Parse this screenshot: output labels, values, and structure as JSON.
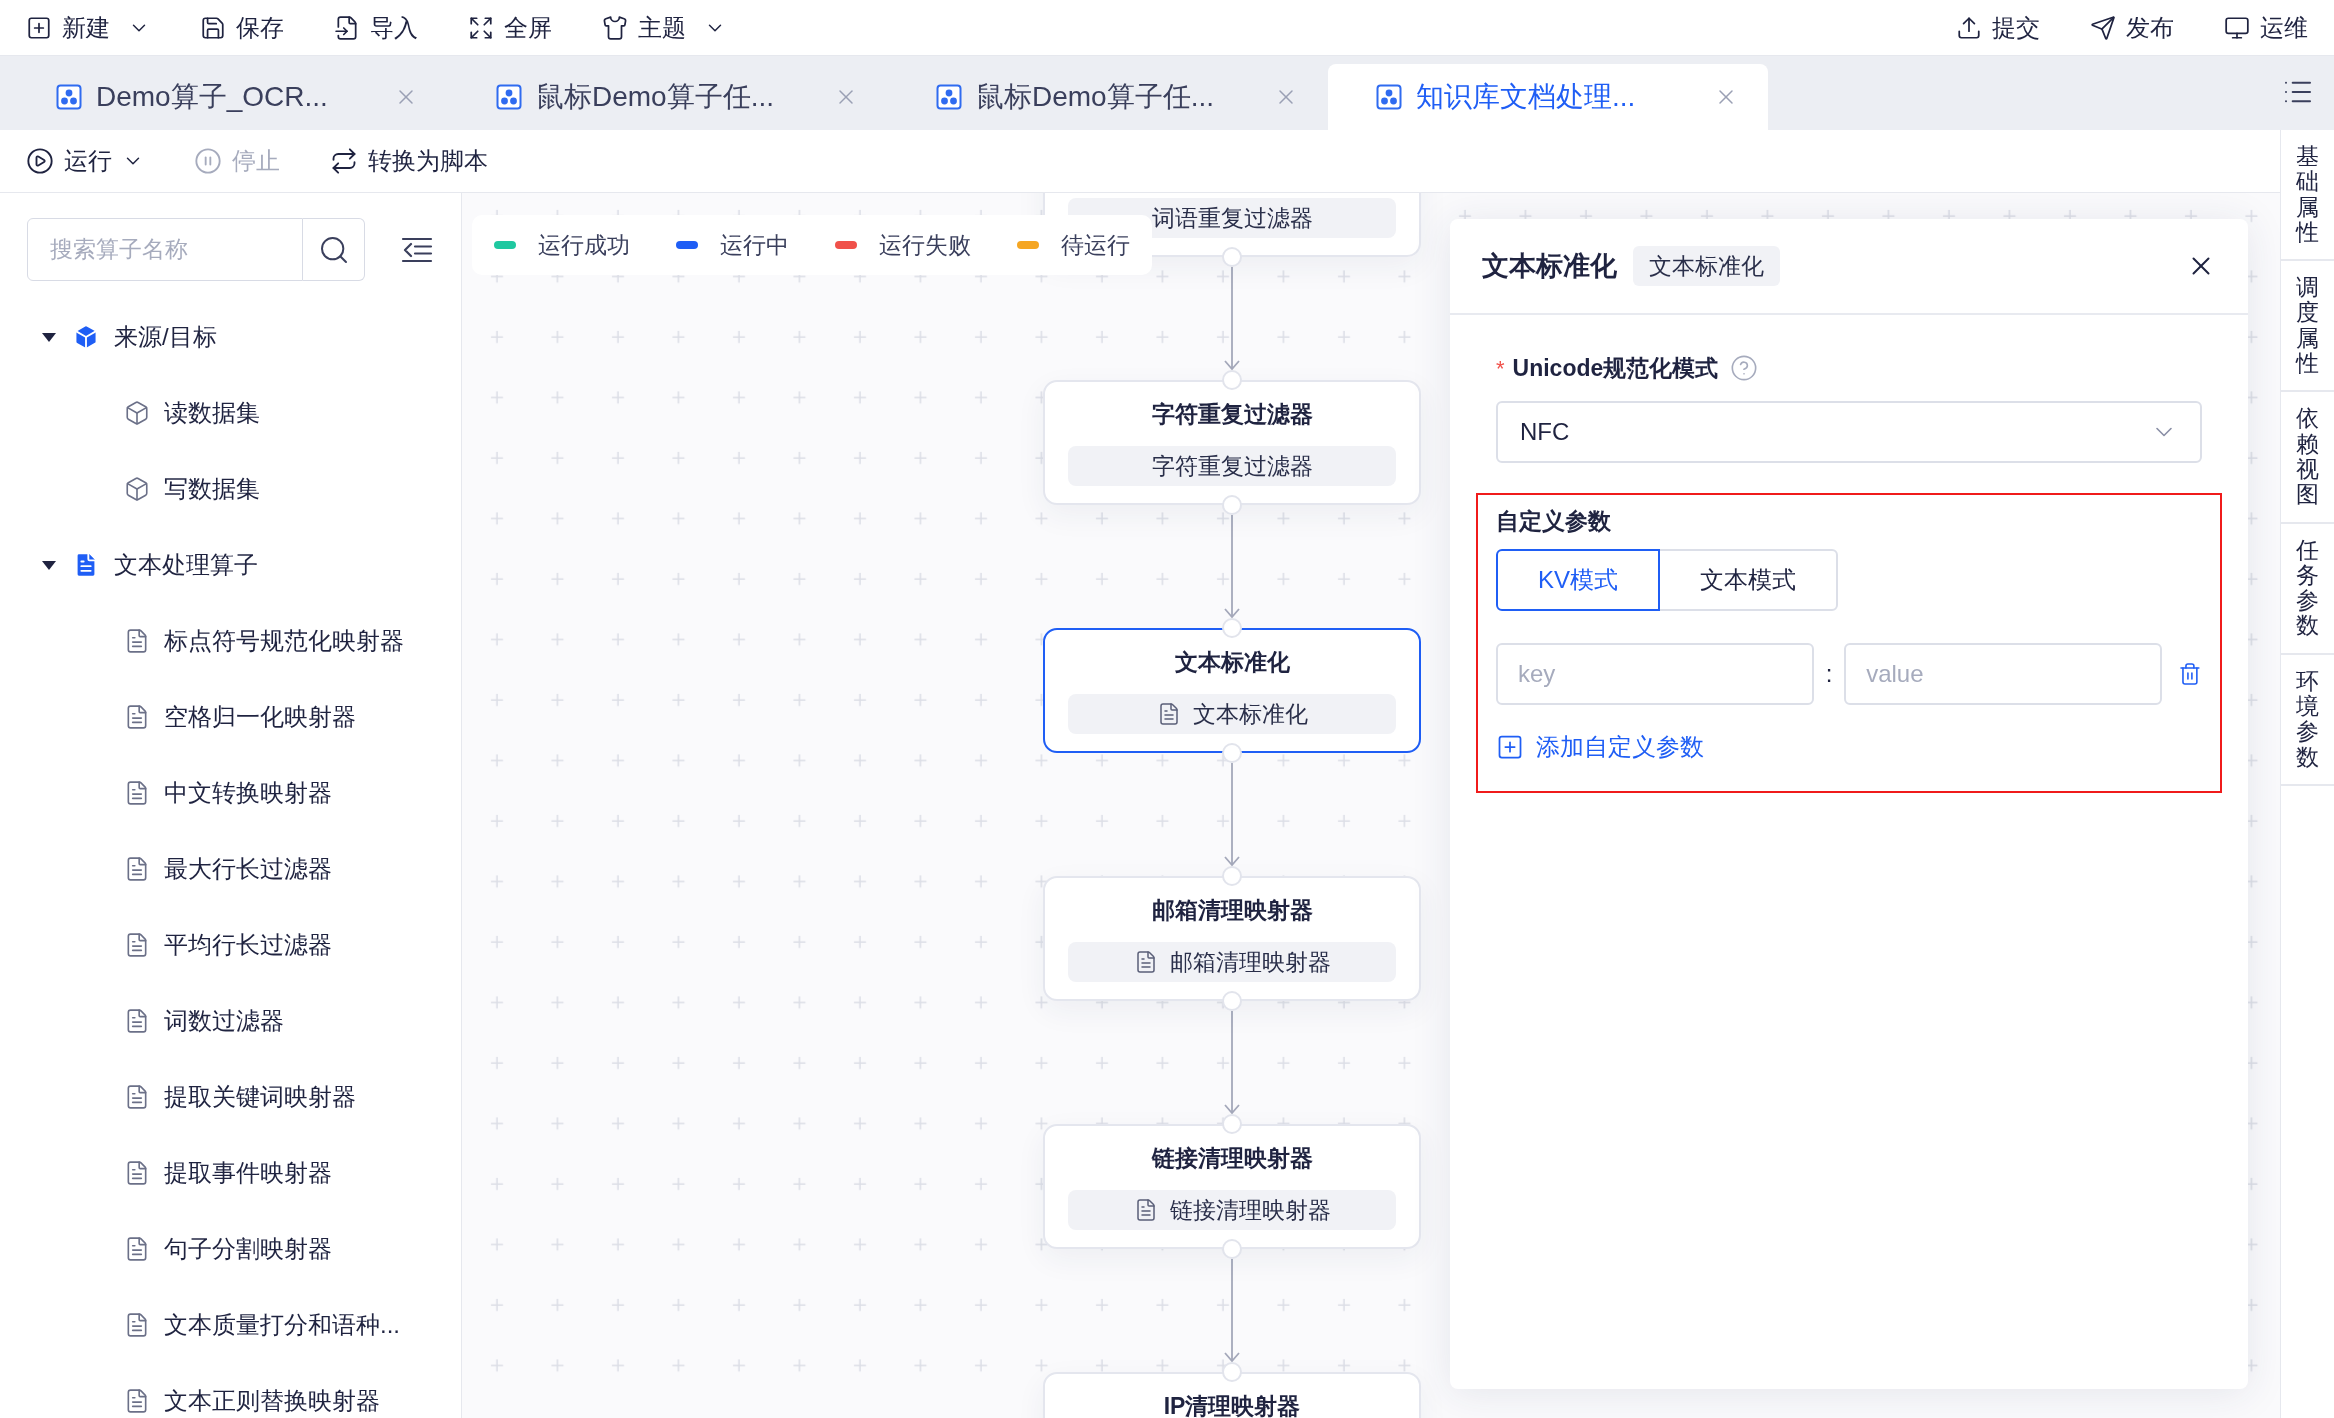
{
  "toolbar": {
    "left": [
      {
        "label": "新建",
        "kind": "new",
        "dropdown": true
      },
      {
        "label": "保存",
        "kind": "save",
        "dropdown": false
      },
      {
        "label": "导入",
        "kind": "import",
        "dropdown": false
      },
      {
        "label": "全屏",
        "kind": "fullscreen",
        "dropdown": false
      },
      {
        "label": "主题",
        "kind": "theme",
        "dropdown": true
      }
    ],
    "right": [
      {
        "label": "提交",
        "kind": "submit"
      },
      {
        "label": "发布",
        "kind": "publish"
      },
      {
        "label": "运维",
        "kind": "ops"
      }
    ]
  },
  "tabs": [
    {
      "label": "Demo算子_OCR...",
      "selected": false
    },
    {
      "label": "鼠标Demo算子任...",
      "selected": false
    },
    {
      "label": "鼠标Demo算子任...",
      "selected": false
    },
    {
      "label": "知识库文档处理...",
      "selected": true
    }
  ],
  "actions": [
    {
      "label": "运行",
      "kind": "run",
      "dropdown": true,
      "disabled": false
    },
    {
      "label": "停止",
      "kind": "stop",
      "dropdown": false,
      "disabled": true
    },
    {
      "label": "转换为脚本",
      "kind": "convert",
      "dropdown": false,
      "disabled": false
    }
  ],
  "sidebar": {
    "search": {
      "placeholder": "搜索算子名称"
    },
    "tree": [
      {
        "label": "来源/目标",
        "kind": "dataset",
        "expanded": true,
        "children": [
          {
            "label": "读数据集"
          },
          {
            "label": "写数据集"
          }
        ]
      },
      {
        "label": "文本处理算子",
        "kind": "operator",
        "expanded": true,
        "children": [
          {
            "label": "标点符号规范化映射器"
          },
          {
            "label": "空格归一化映射器"
          },
          {
            "label": "中文转换映射器"
          },
          {
            "label": "最大行长过滤器"
          },
          {
            "label": "平均行长过滤器"
          },
          {
            "label": "词数过滤器"
          },
          {
            "label": "提取关键词映射器"
          },
          {
            "label": "提取事件映射器"
          },
          {
            "label": "句子分割映射器"
          },
          {
            "label": "文本质量打分和语种..."
          },
          {
            "label": "文本正则替换映射器"
          }
        ]
      }
    ]
  },
  "legend": [
    {
      "label": "运行成功",
      "color": "#1fc8a0"
    },
    {
      "label": "运行中",
      "color": "#1f5ef5"
    },
    {
      "label": "运行失败",
      "color": "#f0514a"
    },
    {
      "label": "待运行",
      "color": "#f5a623"
    }
  ],
  "nodes": [
    {
      "tag": "词语重复过滤器",
      "tag_icon": false,
      "selected": false
    },
    {
      "title": "字符重复过滤器",
      "tag": "字符重复过滤器",
      "tag_icon": false,
      "selected": false
    },
    {
      "title": "文本标准化",
      "tag": "文本标准化",
      "tag_icon": true,
      "selected": true
    },
    {
      "title": "邮箱清理映射器",
      "tag": "邮箱清理映射器",
      "tag_icon": true,
      "selected": false
    },
    {
      "title": "链接清理映射器",
      "tag": "链接清理映射器",
      "tag_icon": true,
      "selected": false
    },
    {
      "title": "IP清理映射器",
      "selected": false
    }
  ],
  "panel": {
    "title": "文本标准化",
    "badge": "文本标准化",
    "field": {
      "label": "Unicode规范化模式",
      "required_mark": "*",
      "value": "NFC"
    },
    "custom": {
      "title": "自定义参数",
      "modes": [
        {
          "label": "KV模式",
          "selected": true
        },
        {
          "label": "文本模式",
          "selected": false
        }
      ],
      "key_placeholder": "key",
      "separator": ":",
      "value_placeholder": "value",
      "add_label": "添加自定义参数"
    }
  },
  "side_tabs": [
    {
      "label": "基础属性"
    },
    {
      "label": "调度属性"
    },
    {
      "label": "依赖视图"
    },
    {
      "label": "任务参数"
    },
    {
      "label": "环境参数"
    }
  ]
}
